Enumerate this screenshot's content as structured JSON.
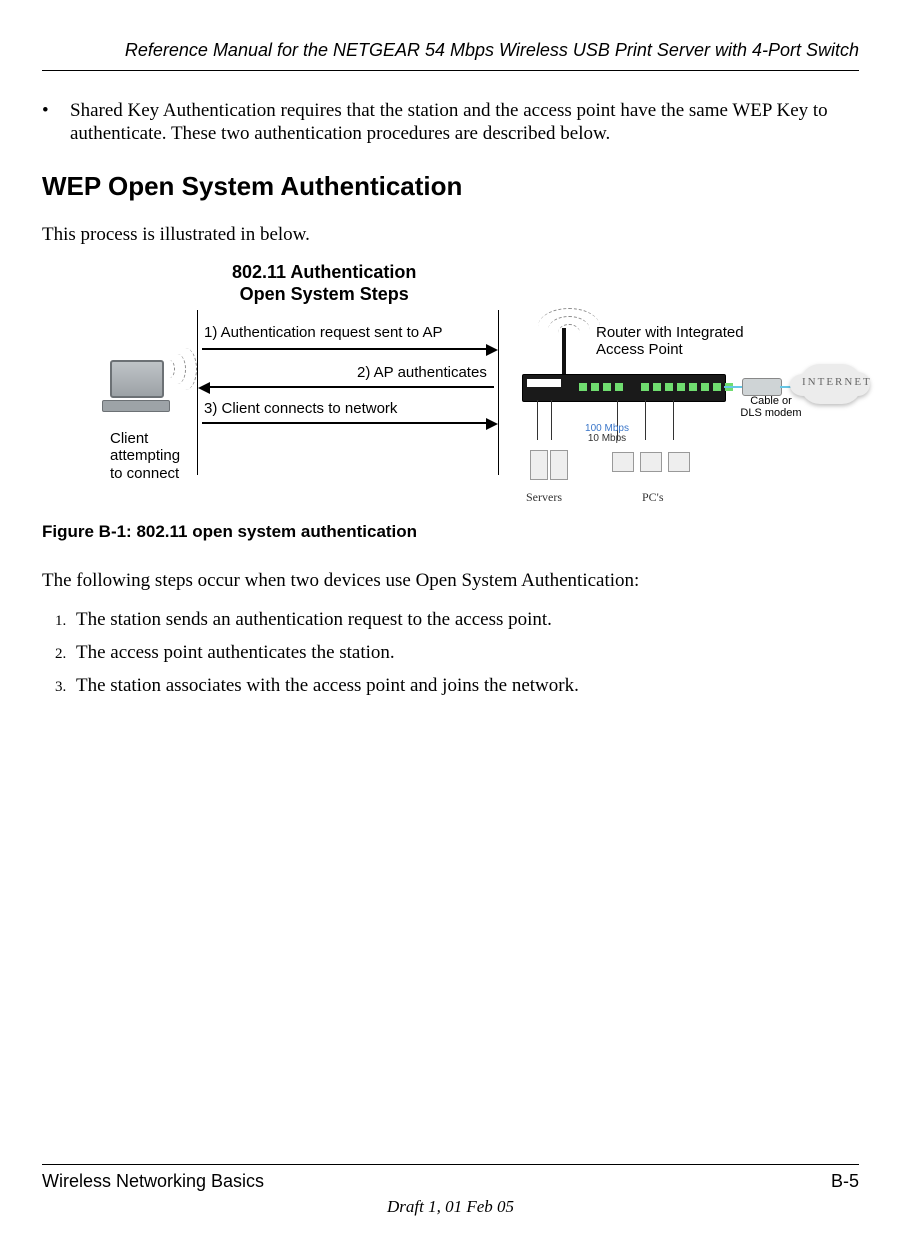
{
  "header": {
    "title": "Reference Manual for the NETGEAR 54 Mbps Wireless USB Print Server with 4-Port Switch"
  },
  "bullet": {
    "mark": "•",
    "text": "Shared Key Authentication requires that the station and the access point have the same WEP Key to authenticate. These two authentication procedures are described below."
  },
  "section_heading": "WEP Open System Authentication",
  "intro": "This process is illustrated in below.",
  "figure": {
    "title_line1": "802.11 Authentication",
    "title_line2": "Open System Steps",
    "step1": "1) Authentication request sent to AP",
    "step2": "2) AP authenticates",
    "step3": "3) Client connects to network",
    "client_label_l1": "Client",
    "client_label_l2": "attempting",
    "client_label_l3": "to connect",
    "router_label_l1": "Router with Integrated",
    "router_label_l2": "Access Point",
    "modem_label_l1": "Cable or",
    "modem_label_l2": "DLS modem",
    "internet_label": "INTERNET",
    "mbps_l1": "100 Mbps",
    "mbps_l2": "10 Mbps",
    "cap_servers": "Servers",
    "cap_pcs": "PC's",
    "caption": "Figure B-1:  802.11 open system authentication"
  },
  "list_intro": "The following steps occur when two devices use Open System Authentication:",
  "steps": {
    "s1": "The station sends an authentication request to the access point.",
    "s2": "The access point authenticates the station.",
    "s3": "The station associates with the access point and joins the network."
  },
  "footer": {
    "left": "Wireless Networking Basics",
    "right": "B-5",
    "draft": "Draft 1, 01 Feb 05"
  }
}
